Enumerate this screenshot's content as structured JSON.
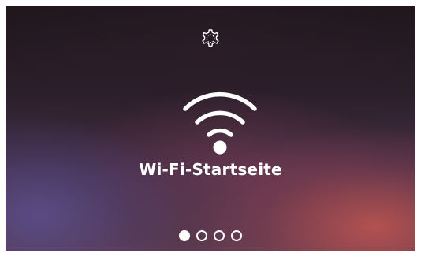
{
  "screen": {
    "title": "Wi-Fi-Startseite",
    "settings_icon": "gear-icon",
    "main_icon": "wifi-icon"
  },
  "pagination": {
    "pages": 4,
    "active_index": 0
  },
  "colors": {
    "foreground": "#ffffff",
    "accent_warm": "#c45650",
    "accent_cool": "#5c5296",
    "background_dark": "#1f161b"
  }
}
